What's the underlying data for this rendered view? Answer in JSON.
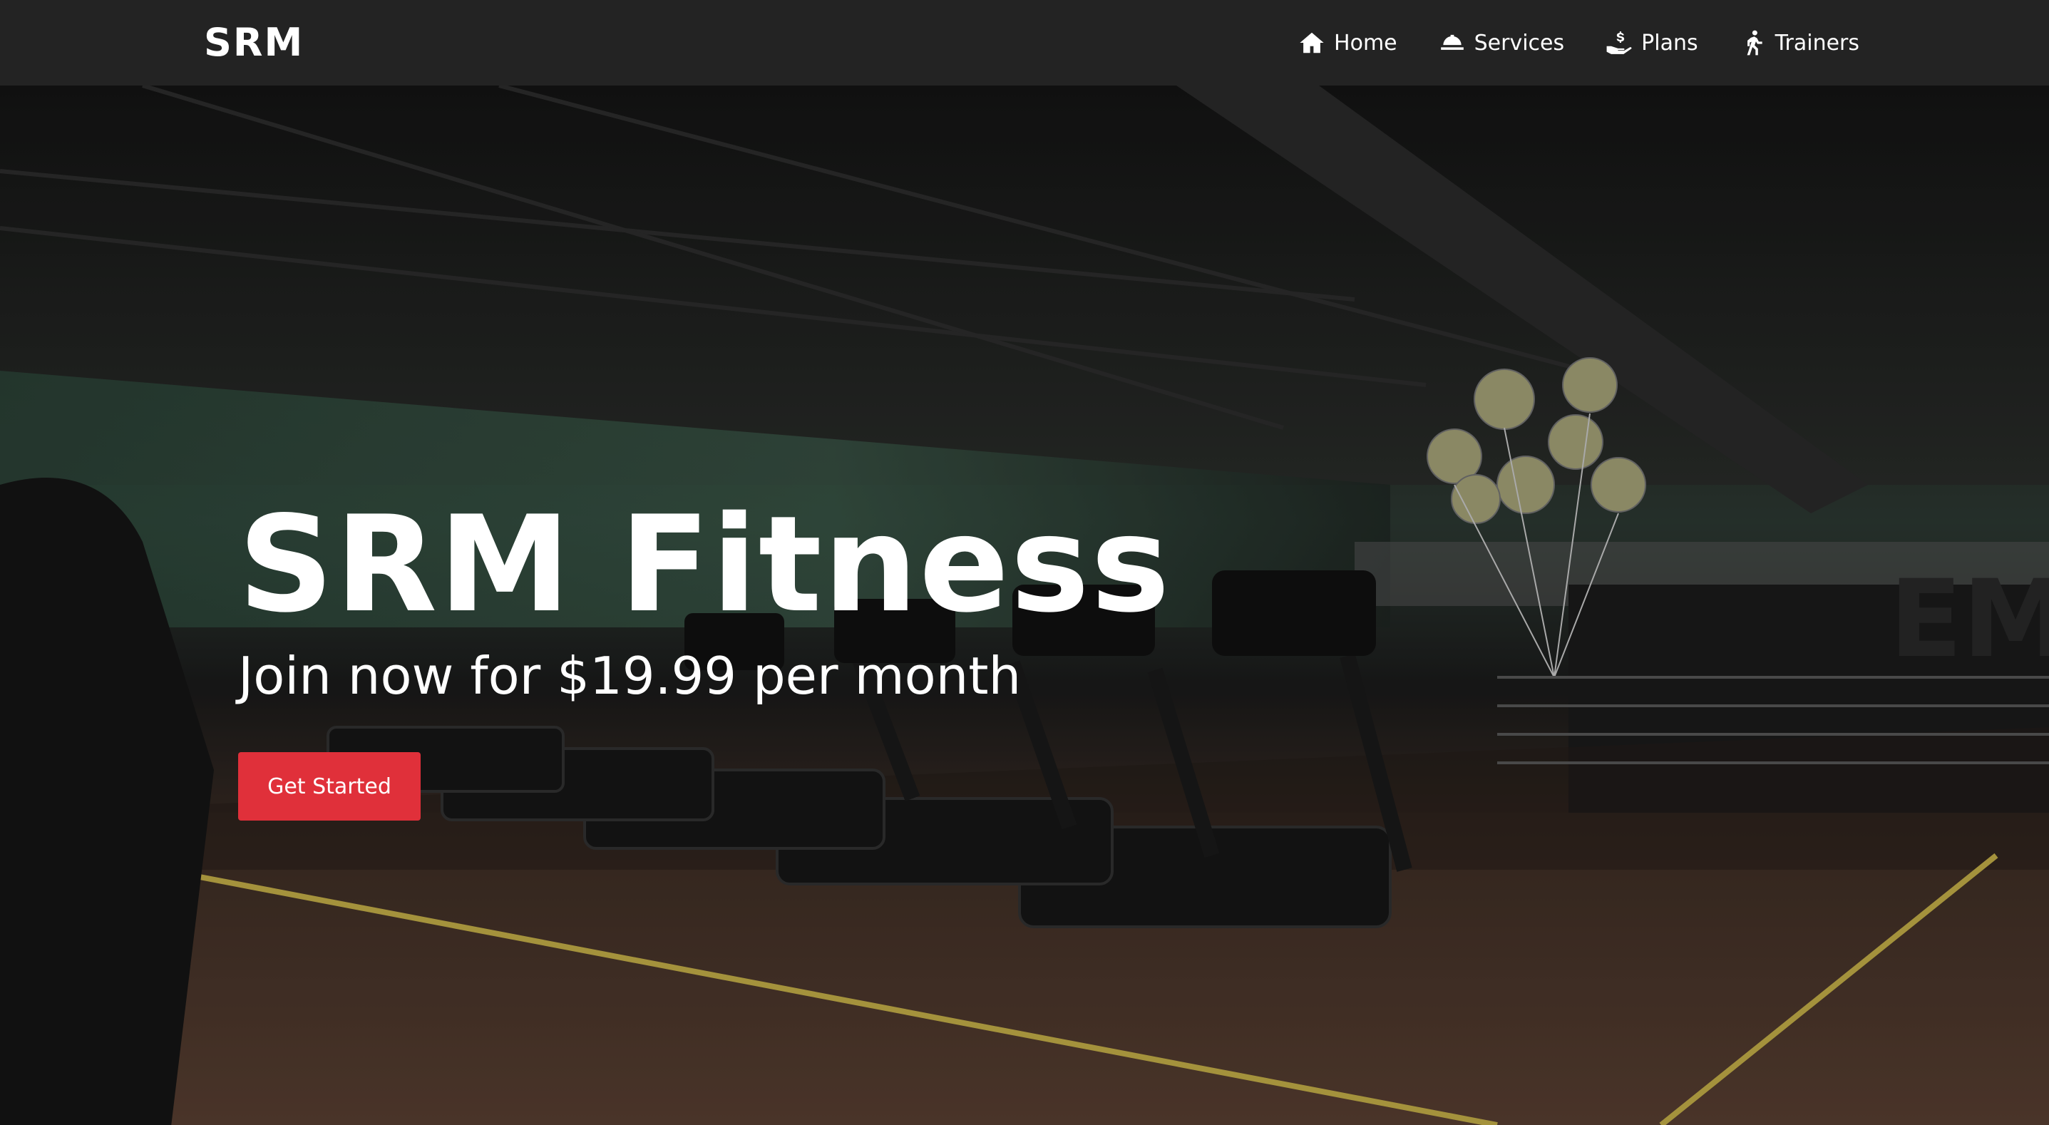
{
  "brand": {
    "logo_text": "SRM"
  },
  "nav": {
    "items": [
      {
        "label": "Home",
        "icon": "home-icon"
      },
      {
        "label": "Services",
        "icon": "service-bell-icon"
      },
      {
        "label": "Plans",
        "icon": "hand-holding-dollar-icon"
      },
      {
        "label": "Trainers",
        "icon": "running-person-icon"
      }
    ]
  },
  "hero": {
    "title": "SRM Fitness",
    "subtitle": "Join now for $19.99 per month",
    "cta_label": "Get Started",
    "background_image": "dark gym interior with row of treadmills, wooden floor and balloons"
  },
  "colors": {
    "navbar_bg": "#232323",
    "cta_bg": "#e0303a",
    "text": "#ffffff"
  }
}
